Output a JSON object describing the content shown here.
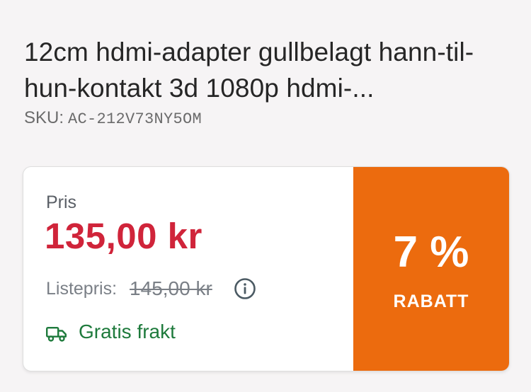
{
  "product": {
    "title": "12cm hdmi-adapter gullbelagt hann-til-hun-kontakt 3d 1080p hdmi-...",
    "sku_label": "SKU:",
    "sku_value": "AC-212V73NY5OM"
  },
  "pricing": {
    "price_label": "Pris",
    "price": "135,00 kr",
    "list_label": "Listepris:",
    "list_price": "145,00 kr",
    "shipping": "Gratis frakt",
    "discount_value": "7 %",
    "discount_label": "RABATT",
    "colors": {
      "price": "#d0243a",
      "shipping": "#1e7a3c",
      "discount_bg": "#ec6b0e"
    },
    "icons": {
      "info": "info-icon",
      "shipping": "truck-icon"
    }
  }
}
